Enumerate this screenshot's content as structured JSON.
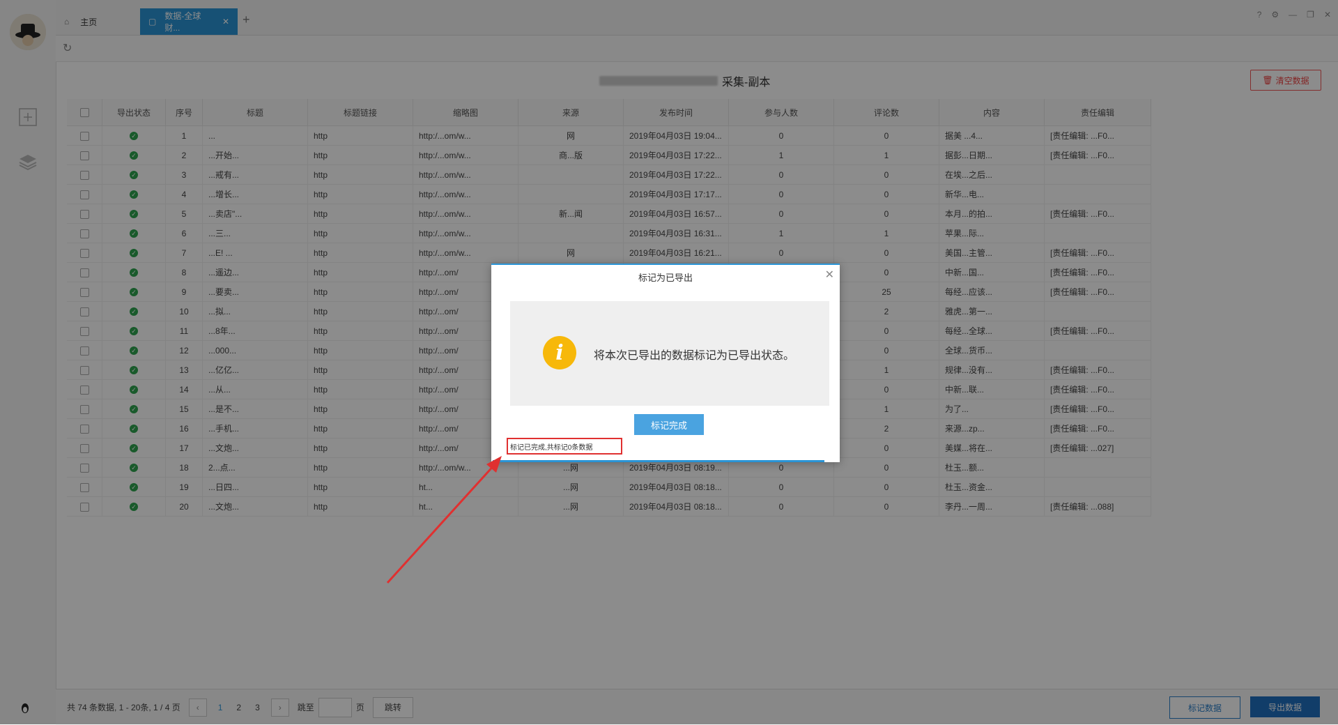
{
  "tabs": {
    "home_label": "主页",
    "active_label": "数据-全球财..."
  },
  "page": {
    "title_suffix": "采集-副本",
    "clear_label": "清空数据"
  },
  "table": {
    "headers": [
      "导出状态",
      "序号",
      "标题",
      "标题链接",
      "缩略图",
      "来源",
      "发布时间",
      "参与人数",
      "评论数",
      "内容",
      "责任编辑"
    ],
    "rows": [
      {
        "seq": "1",
        "title": "...",
        "link": "http",
        "thumb": "http:/...om/w...",
        "source": "网",
        "time": "2019年04月03日 19:04...",
        "join": "0",
        "comments": "0",
        "content": "据美 ...4...",
        "editor": "[责任编辑: ...F0..."
      },
      {
        "seq": "2",
        "title": "...开始...",
        "link": "http",
        "thumb": "http:/...om/w...",
        "source": "商...版",
        "time": "2019年04月03日 17:22...",
        "join": "1",
        "comments": "1",
        "content": "据彭...日期...",
        "editor": "[责任编辑: ...F0..."
      },
      {
        "seq": "3",
        "title": "...戒有...",
        "link": "http",
        "thumb": "http:/...om/w...",
        "source": "",
        "time": "2019年04月03日 17:22...",
        "join": "0",
        "comments": "0",
        "content": "在埃...之后...",
        "editor": ""
      },
      {
        "seq": "4",
        "title": "...增长...",
        "link": "http",
        "thumb": "http:/...om/w...",
        "source": "",
        "time": "2019年04月03日 17:17...",
        "join": "0",
        "comments": "0",
        "content": "新华...电...",
        "editor": ""
      },
      {
        "seq": "5",
        "title": "...卖店\"...",
        "link": "http",
        "thumb": "http:/...om/w...",
        "source": "新...闻",
        "time": "2019年04月03日 16:57...",
        "join": "0",
        "comments": "0",
        "content": "本月...的拍...",
        "editor": "[责任编辑: ...F0..."
      },
      {
        "seq": "6",
        "title": "...三...",
        "link": "http",
        "thumb": "http:/...om/w...",
        "source": "",
        "time": "2019年04月03日 16:31...",
        "join": "1",
        "comments": "1",
        "content": "苹果...际...",
        "editor": ""
      },
      {
        "seq": "7",
        "title": "...E! ...",
        "link": "http",
        "thumb": "http:/...om/w...",
        "source": "网",
        "time": "2019年04月03日 16:21...",
        "join": "0",
        "comments": "0",
        "content": "美国...主管...",
        "editor": "[责任编辑: ...F0..."
      },
      {
        "seq": "8",
        "title": "...遥边...",
        "link": "http",
        "thumb": "http:/...om/",
        "source": "",
        "time": "",
        "join": "",
        "comments": "0",
        "content": "中新...国...",
        "editor": "[责任编辑: ...F0..."
      },
      {
        "seq": "9",
        "title": "...要卖...",
        "link": "http",
        "thumb": "http:/...om/",
        "source": "",
        "time": "",
        "join": "",
        "comments": "25",
        "content": "每经...应该...",
        "editor": "[责任编辑: ...F0..."
      },
      {
        "seq": "10",
        "title": "...拟...",
        "link": "http",
        "thumb": "http:/...om/",
        "source": "",
        "time": "",
        "join": "",
        "comments": "2",
        "content": "雅虎...第一...",
        "editor": ""
      },
      {
        "seq": "11",
        "title": "...8年...",
        "link": "http",
        "thumb": "http:/...om/",
        "source": "",
        "time": "",
        "join": "",
        "comments": "0",
        "content": "每经...全球...",
        "editor": "[责任编辑: ...F0..."
      },
      {
        "seq": "12",
        "title": "...000...",
        "link": "http",
        "thumb": "http:/...om/",
        "source": "",
        "time": "",
        "join": "",
        "comments": "0",
        "content": "全球...货币...",
        "editor": ""
      },
      {
        "seq": "13",
        "title": "...亿亿...",
        "link": "http",
        "thumb": "http:/...om/",
        "source": "",
        "time": "",
        "join": "",
        "comments": "1",
        "content": "规律...没有...",
        "editor": "[责任编辑: ...F0..."
      },
      {
        "seq": "14",
        "title": "...从...",
        "link": "http",
        "thumb": "http:/...om/",
        "source": "",
        "time": "",
        "join": "",
        "comments": "0",
        "content": "中新...联...",
        "editor": "[责任编辑: ...F0..."
      },
      {
        "seq": "15",
        "title": "...是不...",
        "link": "http",
        "thumb": "http:/...om/",
        "source": "",
        "time": "",
        "join": "",
        "comments": "1",
        "content": "为了...",
        "editor": "[责任编辑: ...F0..."
      },
      {
        "seq": "16",
        "title": "...手机...",
        "link": "http",
        "thumb": "http:/...om/",
        "source": "",
        "time": "",
        "join": "",
        "comments": "2",
        "content": "来源...zp...",
        "editor": "[责任编辑: ...F0..."
      },
      {
        "seq": "17",
        "title": "...文炮...",
        "link": "http",
        "thumb": "http:/...om/",
        "source": "",
        "time": "",
        "join": "",
        "comments": "0",
        "content": "美媒...将在...",
        "editor": "[责任编辑: ...027]"
      },
      {
        "seq": "18",
        "title": "2...点...",
        "link": "http",
        "thumb": "http:/...om/w...",
        "source": "...网",
        "time": "2019年04月03日 08:19...",
        "join": "0",
        "comments": "0",
        "content": "杜玉...额...",
        "editor": ""
      },
      {
        "seq": "19",
        "title": "...日四...",
        "link": "http",
        "thumb": "ht...",
        "source": "...网",
        "time": "2019年04月03日 08:18...",
        "join": "0",
        "comments": "0",
        "content": "杜玉...资金...",
        "editor": ""
      },
      {
        "seq": "20",
        "title": "...文炮...",
        "link": "http",
        "thumb": "ht...",
        "source": "...网",
        "time": "2019年04月03日 08:18...",
        "join": "0",
        "comments": "0",
        "content": "李丹...一周...",
        "editor": "[责任编辑: ...088]"
      }
    ]
  },
  "pagination": {
    "summary": "共 74 条数据, 1 - 20条, 1 / 4 页",
    "pages": [
      "1",
      "2",
      "3"
    ],
    "jump_label": "跳至",
    "page_label": "页",
    "jump_btn": "跳转"
  },
  "footer": {
    "mark_label": "标记数据",
    "export_label": "导出数据"
  },
  "dialog": {
    "title": "标记为已导出",
    "message": "将本次已导出的数据标记为已导出状态。",
    "button": "标记完成",
    "status": "标记已完成,共标记0条数据"
  },
  "colors": {
    "accent": "#2a94d6",
    "warning": "#f7b80a",
    "success": "#2ea44f",
    "danger": "#e03030"
  }
}
